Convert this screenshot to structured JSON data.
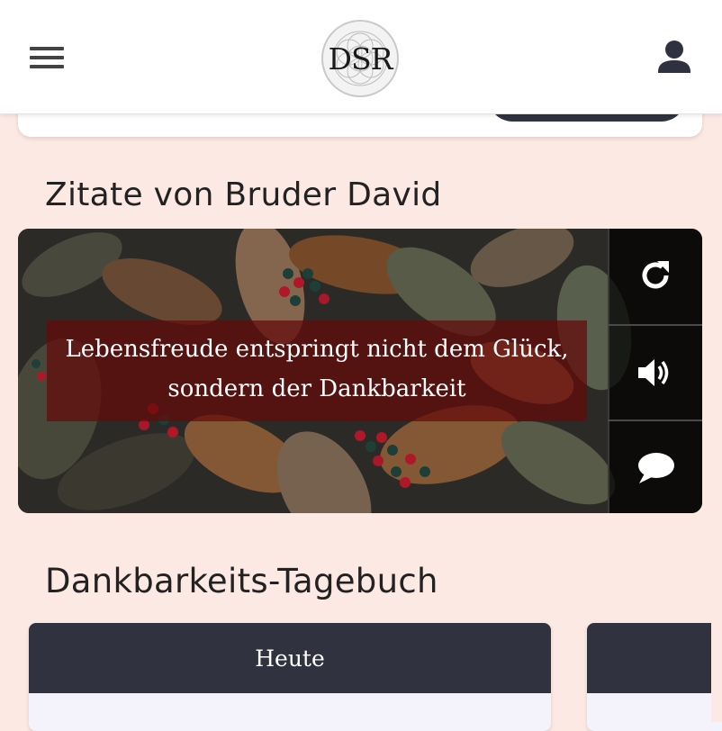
{
  "header": {
    "logo_text": "DSR",
    "menu_icon": "hamburger-menu-icon",
    "user_icon": "user-icon"
  },
  "quotes": {
    "title": "Zitate von Bruder David",
    "text_line1": "Lebensfreude entspringt nicht dem Glück,",
    "text_line2": "sondern der Dankbarkeit",
    "actions": [
      {
        "icon": "refresh-icon"
      },
      {
        "icon": "speaker-icon"
      },
      {
        "icon": "comment-icon"
      }
    ]
  },
  "diary": {
    "title": "Dankbarkeits-Tagebuch",
    "cards": [
      {
        "label": "Heute"
      },
      {
        "label": ""
      }
    ]
  },
  "colors": {
    "page_bg": "#fde9e4",
    "dark_button": "#31323f",
    "quote_band": "#640a0a"
  }
}
